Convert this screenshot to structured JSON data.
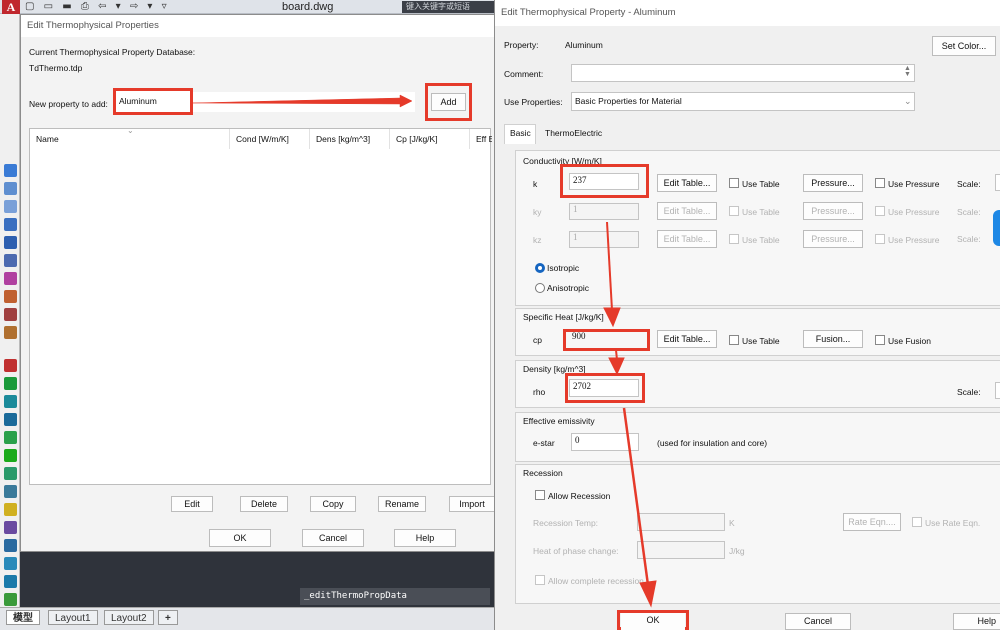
{
  "cad": {
    "logo": "A",
    "qat": "▢ ▭ ▬ ⎙ ⇦ ▾ ⇨ ▾ ▿",
    "file_name": "board.dwg",
    "search_placeholder": "键入关键字或短语",
    "command_text": "_editThermoPropData",
    "layout_tabs": [
      "模型",
      "Layout1",
      "Layout2",
      "+"
    ]
  },
  "dialog1": {
    "title": "Edit Thermophysical Properties",
    "db_label": "Current Thermophysical Property Database:",
    "db_file": "TdThermo.tdp",
    "new_prop_label": "New property to add:",
    "new_prop_value": "Aluminum",
    "add_button": "Add",
    "columns": [
      "Name",
      "Cond [W/m/K]",
      "Dens [kg/m^3]",
      "Cp [J/kg/K]",
      "Eff Em"
    ],
    "buttons": [
      "Edit",
      "Delete",
      "Copy",
      "Rename",
      "Import"
    ],
    "bottom_buttons": [
      "OK",
      "Cancel",
      "Help"
    ]
  },
  "dialog2": {
    "title": "Edit Thermophysical Property - Aluminum",
    "property_label": "Property:",
    "property_value": "Aluminum",
    "set_color_button": "Set Color...",
    "comment_label": "Comment:",
    "use_props_label": "Use Properties:",
    "use_props_value": "Basic Properties for Material",
    "tabs": [
      "Basic",
      "ThermoElectric"
    ],
    "conductivity": {
      "header": "Conductivity  [W/m/K]",
      "rows": [
        {
          "label": "k",
          "value": "237"
        },
        {
          "label": "ky",
          "value": "1"
        },
        {
          "label": "kz",
          "value": "1"
        }
      ],
      "edit_table": "Edit Table...",
      "use_table": "Use Table",
      "pressure": "Pressure...",
      "use_pressure": "Use Pressure",
      "scale": "Scale:",
      "isotropic": "Isotropic",
      "anisotropic": "Anisotropic"
    },
    "specific_heat": {
      "header": "Specific Heat  [J/kg/K]",
      "label": "cp",
      "value": "900",
      "edit_table": "Edit Table...",
      "use_table": "Use Table",
      "fusion": "Fusion...",
      "use_fusion": "Use Fusion"
    },
    "density": {
      "header": "Density  [kg/m^3]",
      "label": "rho",
      "value": "2702",
      "scale": "Scale:"
    },
    "emissivity": {
      "header": "Effective emissivity",
      "label": "e-star",
      "value": "0",
      "note": "(used for insulation and core)"
    },
    "recession": {
      "header": "Recession",
      "allow": "Allow Recession",
      "temp_label": "Recession Temp:",
      "temp_unit": "K",
      "rate_eqn": "Rate Eqn....",
      "use_rate": "Use Rate Eqn.",
      "heat_label": "Heat of phase change:",
      "heat_unit": "J/kg",
      "allow_complete": "Allow complete recession"
    },
    "bottom_buttons": {
      "ok": "OK",
      "cancel": "Cancel",
      "help": "Help"
    }
  },
  "colors": {
    "highlight": "#e53a2a",
    "radio_accent": "#1565c0"
  }
}
